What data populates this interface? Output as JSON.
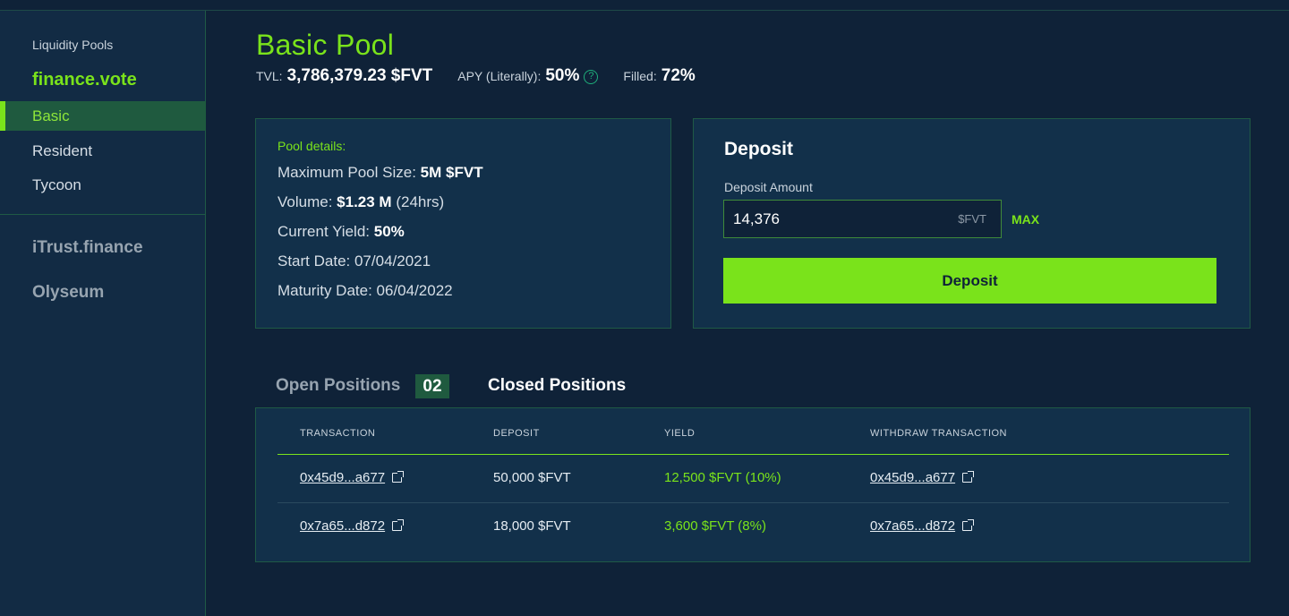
{
  "sidebar": {
    "heading": "Liquidity Pools",
    "project": "finance.vote",
    "items": [
      {
        "label": "Basic",
        "active": true
      },
      {
        "label": "Resident",
        "active": false
      },
      {
        "label": "Tycoon",
        "active": false
      }
    ],
    "other_projects": [
      "iTrust.finance",
      "Olyseum"
    ]
  },
  "pool": {
    "title": "Basic Pool",
    "tvl_label": "TVL:",
    "tvl_value": "3,786,379.23 $FVT",
    "apy_label": "APY (Literally):",
    "apy_value": "50%",
    "help_icon": "?",
    "filled_label": "Filled:",
    "filled_value": "72%"
  },
  "details": {
    "label": "Pool details:",
    "max_size_label": "Maximum Pool Size:",
    "max_size_value": "5M $FVT",
    "volume_label": "Volume:",
    "volume_value": "$1.23 M",
    "volume_period": "(24hrs)",
    "yield_label": "Current Yield:",
    "yield_value": "50%",
    "start_date": "Start Date: 07/04/2021",
    "maturity_date": "Maturity Date: 06/04/2022"
  },
  "deposit": {
    "title": "Deposit",
    "amount_label": "Deposit Amount",
    "amount_value": "14,376",
    "unit": "$FVT",
    "max_label": "MAX",
    "button_label": "Deposit"
  },
  "tabs": {
    "open_label": "Open Positions",
    "open_count": "02",
    "closed_label": "Closed Positions"
  },
  "table": {
    "headers": [
      "TRANSACTION",
      "DEPOSIT",
      "YIELD",
      "WITHDRAW TRANSACTION"
    ],
    "rows": [
      {
        "tx": "0x45d9...a677",
        "deposit": "50,000 $FVT",
        "yield": "12,500 $FVT (10%)",
        "withdraw": "0x45d9...a677"
      },
      {
        "tx": "0x7a65...d872",
        "deposit": "18,000 $FVT",
        "yield": "3,600 $FVT (8%)",
        "withdraw": "0x7a65...d872"
      }
    ]
  },
  "colors": {
    "accent": "#7ae31b",
    "background": "#0f2238",
    "card": "#12304a",
    "sidebar": "#122b44"
  }
}
